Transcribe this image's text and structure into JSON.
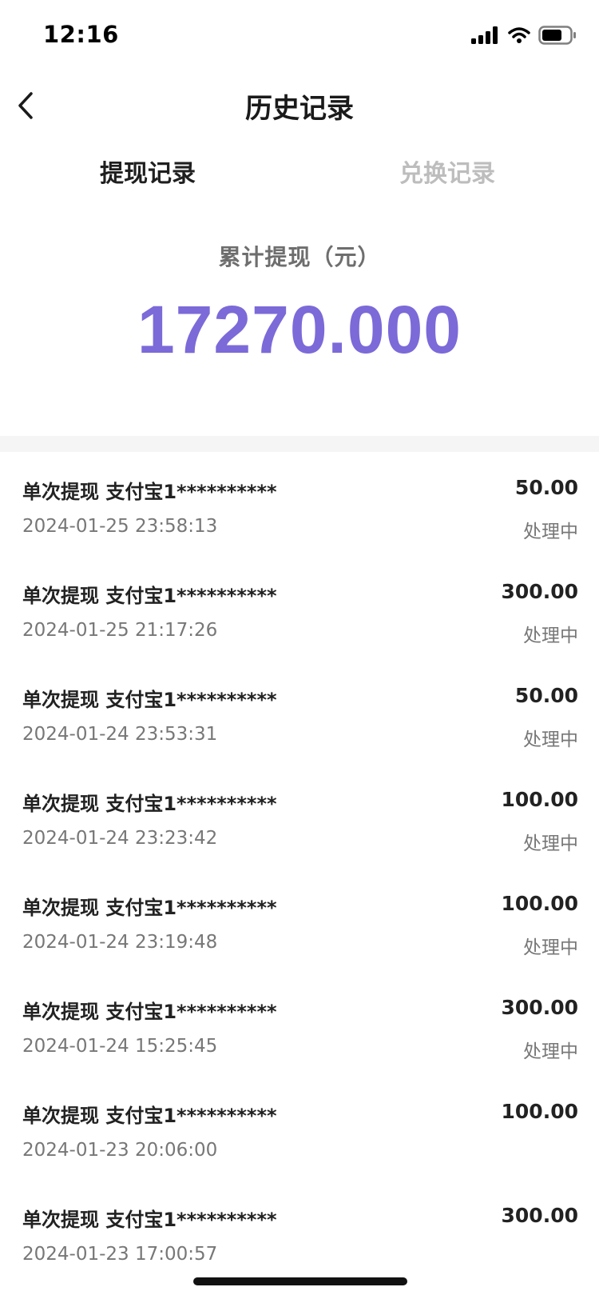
{
  "colors": {
    "accent": "#7B6AD8"
  },
  "status_bar": {
    "time": "12:16",
    "icons": [
      "signal-icon",
      "wifi-icon",
      "battery-icon"
    ]
  },
  "nav": {
    "title": "历史记录",
    "back_icon": "chevron-left-icon"
  },
  "tabs": [
    {
      "label": "提现记录",
      "active": true
    },
    {
      "label": "兑换记录",
      "active": false
    }
  ],
  "summary": {
    "label": "累计提现（元）",
    "amount": "17270.000"
  },
  "records": [
    {
      "title": "单次提现 支付宝1**********",
      "amount": "50.00",
      "time": "2024-01-25 23:58:13",
      "status": "处理中"
    },
    {
      "title": "单次提现 支付宝1**********",
      "amount": "300.00",
      "time": "2024-01-25 21:17:26",
      "status": "处理中"
    },
    {
      "title": "单次提现 支付宝1**********",
      "amount": "50.00",
      "time": "2024-01-24 23:53:31",
      "status": "处理中"
    },
    {
      "title": "单次提现 支付宝1**********",
      "amount": "100.00",
      "time": "2024-01-24 23:23:42",
      "status": "处理中"
    },
    {
      "title": "单次提现 支付宝1**********",
      "amount": "100.00",
      "time": "2024-01-24 23:19:48",
      "status": "处理中"
    },
    {
      "title": "单次提现 支付宝1**********",
      "amount": "300.00",
      "time": "2024-01-24 15:25:45",
      "status": "处理中"
    },
    {
      "title": "单次提现 支付宝1**********",
      "amount": "100.00",
      "time": "2024-01-23 20:06:00",
      "status": ""
    },
    {
      "title": "单次提现 支付宝1**********",
      "amount": "300.00",
      "time": "2024-01-23 17:00:57",
      "status": ""
    }
  ]
}
